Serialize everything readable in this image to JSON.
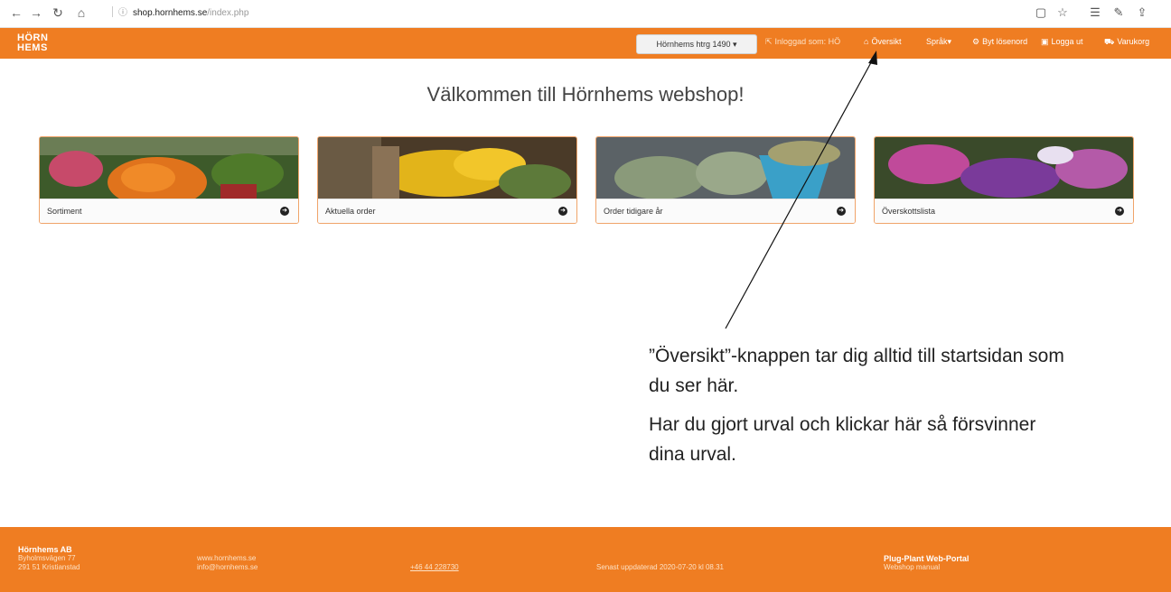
{
  "browser": {
    "url_domain": "shop.hornhems.se",
    "url_path": "/index.php"
  },
  "navbar": {
    "logo_line1": "HÖRN",
    "logo_line2": "HEMS",
    "store_select": "Hörnhems htrg 1490 ▾",
    "logged_in": "Inloggad som: HÖ",
    "overview": "Översikt",
    "language": "Språk▾",
    "change_password": "Byt lösenord",
    "logout": "Logga ut",
    "cart": "Varukorg"
  },
  "main": {
    "welcome": "Välkommen till Hörnhems webshop!",
    "cards": [
      {
        "label": "Sortiment"
      },
      {
        "label": "Aktuella order"
      },
      {
        "label": "Order tidigare år"
      },
      {
        "label": "Överskottslista"
      }
    ]
  },
  "annotation": {
    "para1": "”Översikt”-knappen tar dig alltid till startsidan som du ser här.",
    "para2": "Har du gjort urval och klickar här så försvinner dina urval."
  },
  "footer": {
    "company": "Hörnhems AB",
    "street": "Byholmsvägen 77",
    "city": "291 51 Kristianstad",
    "website": "www.hornhems.se",
    "email": "info@hornhems.se",
    "phone": "+46 44 228730",
    "updated": "Senast uppdaterad 2020-07-20 kl 08.31",
    "portal": "Plug-Plant Web-Portal",
    "manual": "Webshop manual"
  },
  "colors": {
    "brand_orange": "#ef7d22",
    "card_border": "#f0a46a"
  }
}
